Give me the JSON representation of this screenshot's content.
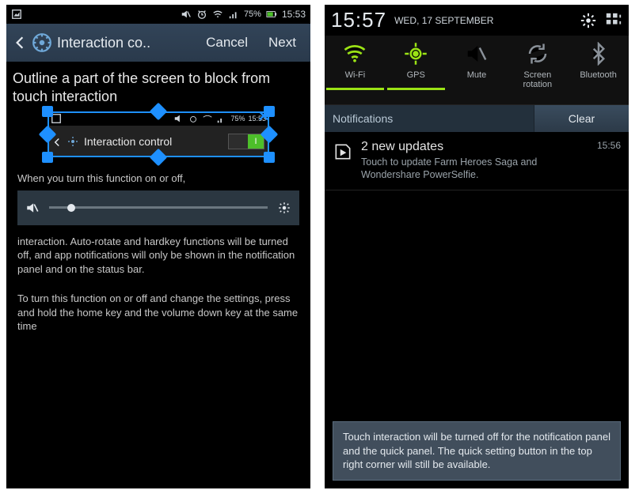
{
  "left": {
    "status": {
      "battery": "75%",
      "time": "15:53"
    },
    "header": {
      "title": "Interaction co..",
      "cancel": "Cancel",
      "next": "Next"
    },
    "instruction": "Outline a part of the screen to block from touch interaction",
    "inner": {
      "battery": "75%",
      "time": "15:53",
      "title": "Interaction control",
      "toggle": "I"
    },
    "body_top": "When you turn this function on or off,",
    "body_mid": "interaction. Auto-rotate and hardkey functions will be turned off, and app notifications will only be shown in the notification panel and on the status bar.",
    "body_bottom": "To turn this function on or off and change the settings, press and hold the home key and the volume down key at the same time"
  },
  "right": {
    "clock": "15:57",
    "date": "WED, 17 SEPTEMBER",
    "quick": [
      {
        "label": "Wi-Fi",
        "active": true
      },
      {
        "label": "GPS",
        "active": true
      },
      {
        "label": "Mute",
        "active": false
      },
      {
        "label": "Screen rotation",
        "active": false
      },
      {
        "label": "Bluetooth",
        "active": false
      }
    ],
    "notif_label": "Notifications",
    "clear": "Clear",
    "notif": {
      "title": "2 new updates",
      "body": "Touch to update Farm Heroes Saga and Wondershare PowerSelfie.",
      "time": "15:56"
    },
    "tooltip": "Touch interaction will be turned off for the notification panel and the quick panel. The quick setting button in the top right corner will still be available."
  }
}
